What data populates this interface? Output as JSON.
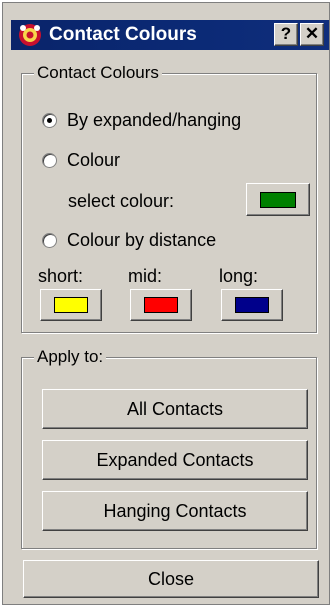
{
  "window": {
    "title": "Contact Colours"
  },
  "titlebar_buttons": {
    "help": "?",
    "close": "✕"
  },
  "contact_colours": {
    "legend": "Contact Colours",
    "options": {
      "by_expanded_hanging": "By expanded/hanging",
      "colour": "Colour",
      "colour_by_distance": "Colour by distance"
    },
    "selected_option": "by_expanded_hanging",
    "select_colour_label": "select colour:",
    "select_colour_value": "#008000",
    "distance": {
      "short_label": "short:",
      "mid_label": "mid:",
      "long_label": "long:",
      "short_colour": "#ffff00",
      "mid_colour": "#ff0000",
      "long_colour": "#00008b"
    }
  },
  "apply_to": {
    "legend": "Apply to:",
    "all_contacts": "All Contacts",
    "expanded_contacts": "Expanded Contacts",
    "hanging_contacts": "Hanging Contacts"
  },
  "footer": {
    "close_label": "Close"
  }
}
